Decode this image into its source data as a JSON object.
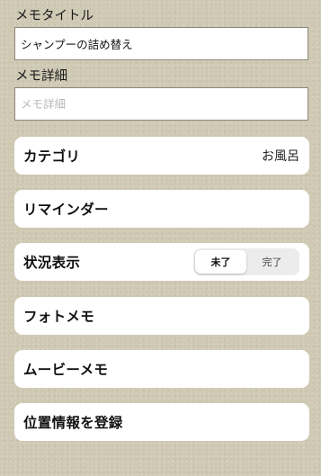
{
  "memo_title": {
    "label": "メモタイトル",
    "value": "シャンプーの詰め替え"
  },
  "memo_detail": {
    "label": "メモ詳細",
    "placeholder": "メモ詳細"
  },
  "category": {
    "label": "カテゴリ",
    "value": "お風呂"
  },
  "reminder": {
    "label": "リマインダー"
  },
  "status": {
    "label": "状況表示",
    "options": [
      "未了",
      "完了"
    ],
    "selected": "未了"
  },
  "photo_memo": {
    "label": "フォトメモ"
  },
  "movie_memo": {
    "label": "ムービーメモ"
  },
  "location": {
    "label": "位置情報を登録"
  }
}
